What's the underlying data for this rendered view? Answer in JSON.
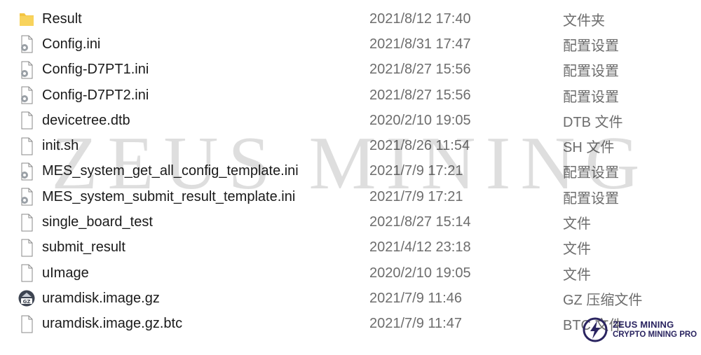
{
  "files": [
    {
      "name": "Result",
      "date": "2021/8/12 17:40",
      "type": "文件夹",
      "icon": "folder-icon"
    },
    {
      "name": "Config.ini",
      "date": "2021/8/31 17:47",
      "type": "配置设置",
      "icon": "settings-file-icon"
    },
    {
      "name": "Config-D7PT1.ini",
      "date": "2021/8/27 15:56",
      "type": "配置设置",
      "icon": "settings-file-icon"
    },
    {
      "name": "Config-D7PT2.ini",
      "date": "2021/8/27 15:56",
      "type": "配置设置",
      "icon": "settings-file-icon"
    },
    {
      "name": "devicetree.dtb",
      "date": "2020/2/10 19:05",
      "type": "DTB 文件",
      "icon": "file-icon"
    },
    {
      "name": "init.sh",
      "date": "2021/8/26 11:54",
      "type": "SH 文件",
      "icon": "file-icon"
    },
    {
      "name": "MES_system_get_all_config_template.ini",
      "date": "2021/7/9 17:21",
      "type": "配置设置",
      "icon": "settings-file-icon"
    },
    {
      "name": "MES_system_submit_result_template.ini",
      "date": "2021/7/9 17:21",
      "type": "配置设置",
      "icon": "settings-file-icon"
    },
    {
      "name": "single_board_test",
      "date": "2021/8/27 15:14",
      "type": "文件",
      "icon": "file-icon"
    },
    {
      "name": "submit_result",
      "date": "2021/4/12 23:18",
      "type": "文件",
      "icon": "file-icon"
    },
    {
      "name": "uImage",
      "date": "2020/2/10 19:05",
      "type": "文件",
      "icon": "file-icon"
    },
    {
      "name": "uramdisk.image.gz",
      "date": "2021/7/9 11:46",
      "type": "GZ 压缩文件",
      "icon": "gz-archive-icon"
    },
    {
      "name": "uramdisk.image.gz.btc",
      "date": "2021/7/9 11:47",
      "type": "BTC 文件",
      "icon": "file-icon"
    }
  ],
  "watermark": "ZEUS MINING",
  "brand": {
    "line1": "ZEUS MINING",
    "line2": "CRYPTO MINING PRO"
  },
  "colors": {
    "folder": "#f4c542",
    "accent": "#2a2460",
    "secondary_text": "#6d6d6d"
  }
}
